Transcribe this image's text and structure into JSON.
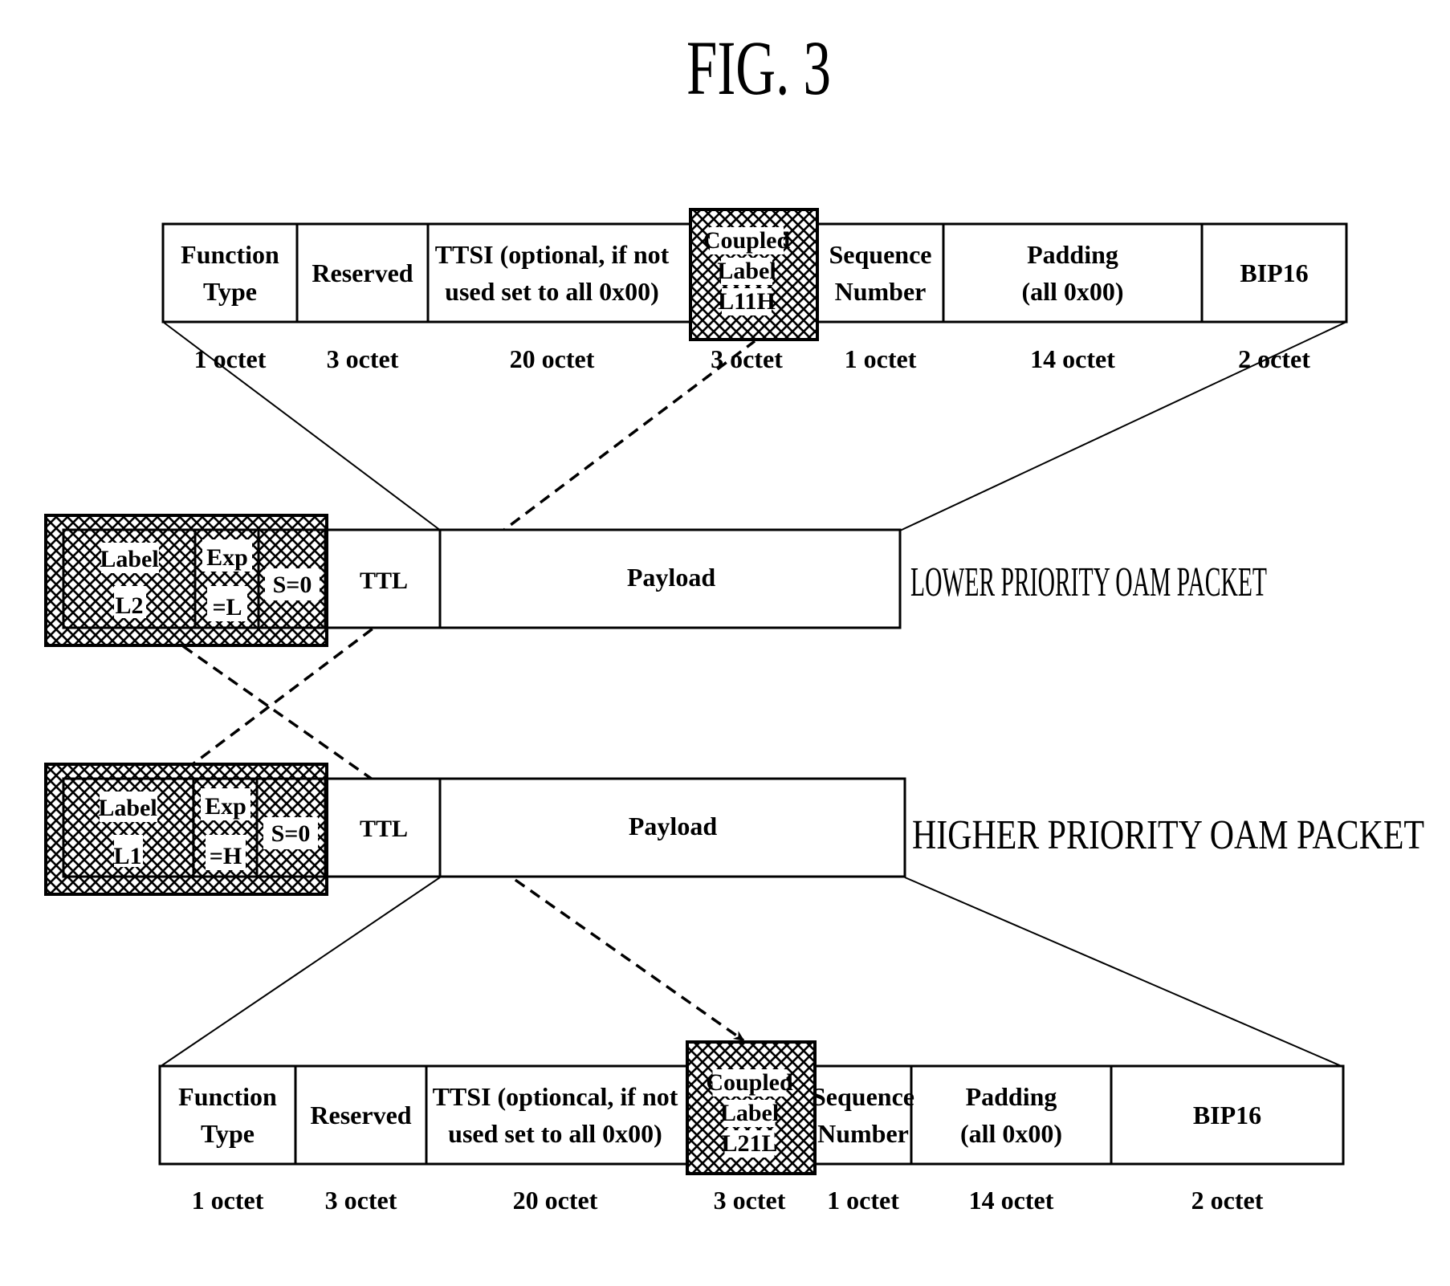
{
  "figure": {
    "title": "FIG. 3"
  },
  "top_frame": {
    "fields": [
      {
        "lines": [
          "Function",
          "Type"
        ],
        "size": "1 octet"
      },
      {
        "lines": [
          "Reserved"
        ],
        "size": "3 octet"
      },
      {
        "lines": [
          "TTSI (optional, if not",
          "used set to all 0x00)"
        ],
        "size": "20 octet"
      },
      {
        "lines": [
          "Coupled",
          "Label",
          "L11H"
        ],
        "size": "3 octet",
        "hatched": true
      },
      {
        "lines": [
          "Sequence",
          "Number"
        ],
        "size": "1 octet"
      },
      {
        "lines": [
          "Padding",
          "(all 0x00)"
        ],
        "size": "14 octet"
      },
      {
        "lines": [
          "BIP16"
        ],
        "size": "2 octet"
      }
    ]
  },
  "lower_packet": {
    "caption": "LOWER PRIORITY OAM PACKET",
    "label": [
      "Label",
      "L2"
    ],
    "exp": [
      "Exp",
      "=L"
    ],
    "s": "S=0",
    "ttl": "TTL",
    "payload": "Payload"
  },
  "higher_packet": {
    "caption": "HIGHER PRIORITY OAM PACKET",
    "label": [
      "Label",
      "L1"
    ],
    "exp": [
      "Exp",
      "=H"
    ],
    "s": "S=0",
    "ttl": "TTL",
    "payload": "Payload"
  },
  "bottom_frame": {
    "fields": [
      {
        "lines": [
          "Function",
          "Type"
        ],
        "size": "1 octet"
      },
      {
        "lines": [
          "Reserved"
        ],
        "size": "3 octet"
      },
      {
        "lines": [
          "TTSI (optioncal, if not",
          "used set to all 0x00)"
        ],
        "size": "20 octet"
      },
      {
        "lines": [
          "Coupled",
          "Label",
          "L21L"
        ],
        "size": "3 octet",
        "hatched": true
      },
      {
        "lines": [
          "Sequence",
          "Number"
        ],
        "size": "1 octet"
      },
      {
        "lines": [
          "Padding",
          "(all 0x00)"
        ],
        "size": "14 octet"
      },
      {
        "lines": [
          "BIP16"
        ],
        "size": "2 octet"
      }
    ]
  },
  "links": [
    {
      "from": "lower_packet.label",
      "to": "bottom_frame.coupled_label",
      "style": "dashed-arrow"
    },
    {
      "from": "higher_packet.label",
      "to": "top_frame.coupled_label",
      "style": "dashed"
    }
  ]
}
